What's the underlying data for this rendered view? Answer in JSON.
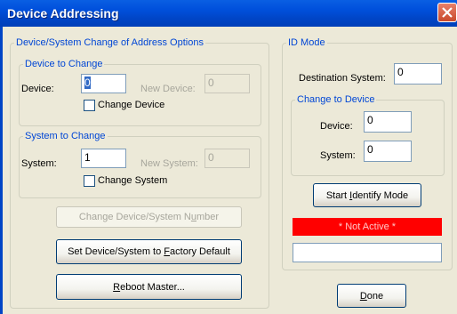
{
  "window": {
    "title": "Device Addressing"
  },
  "left_group": {
    "legend": "Device/System Change of Address Options",
    "device_to_change": {
      "legend": "Device to Change",
      "device_label": "Device:",
      "device_value": "0",
      "new_device_label": "New Device:",
      "new_device_value": "0",
      "checkbox_label": "Change Device"
    },
    "system_to_change": {
      "legend": "System to Change",
      "system_label": "System:",
      "system_value": "1",
      "new_system_label": "New System:",
      "new_system_value": "0",
      "checkbox_label": "Change System"
    },
    "buttons": {
      "change_pre": "Change Device/System N",
      "change_ul": "u",
      "change_post": "mber",
      "factory_pre": "Set Device/System to ",
      "factory_ul": "F",
      "factory_post": "actory Default",
      "reboot_ul": "R",
      "reboot_post": "eboot Master..."
    }
  },
  "id_mode": {
    "legend": "ID Mode",
    "destination_label": "Destination System:",
    "destination_value": "0",
    "change_to_device": {
      "legend": "Change to Device",
      "device_label": "Device:",
      "device_value": "0",
      "system_label": "System:",
      "system_value": "0"
    },
    "start_pre": "Start ",
    "start_ul": "I",
    "start_post": "dentify Mode",
    "status_text": "* Not Active *",
    "status_color": "#ff0000",
    "message_value": ""
  },
  "done_ul": "D",
  "done_post": "one"
}
